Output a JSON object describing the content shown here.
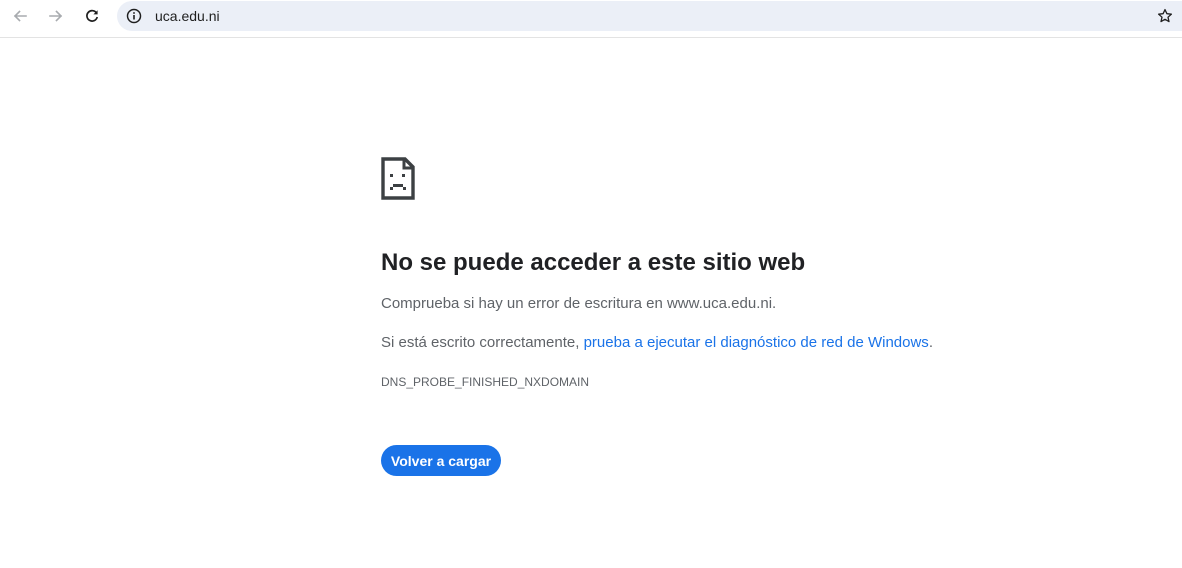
{
  "browser": {
    "url": "uca.edu.ni",
    "icons": {
      "back": "arrow-left-icon",
      "forward": "arrow-right-icon",
      "reload": "reload-icon",
      "site_info": "info-icon",
      "bookmark": "star-icon"
    }
  },
  "error_page": {
    "icon": "sad-document-icon",
    "title": "No se puede acceder a este sitio web",
    "paragraph1": "Comprueba si hay un error de escritura en www.uca.edu.ni.",
    "paragraph2_prefix": "Si está escrito correctamente, ",
    "diagnostic_link": "prueba a ejecutar el diagnóstico de red de Windows",
    "paragraph2_suffix": ".",
    "error_code": "DNS_PROBE_FINISHED_NXDOMAIN",
    "reload_button": "Volver a cargar"
  },
  "colors": {
    "accent": "#1a73e8",
    "title_text": "#202124",
    "body_text": "#5f6368",
    "omnibox_bg": "#ebeff7"
  }
}
